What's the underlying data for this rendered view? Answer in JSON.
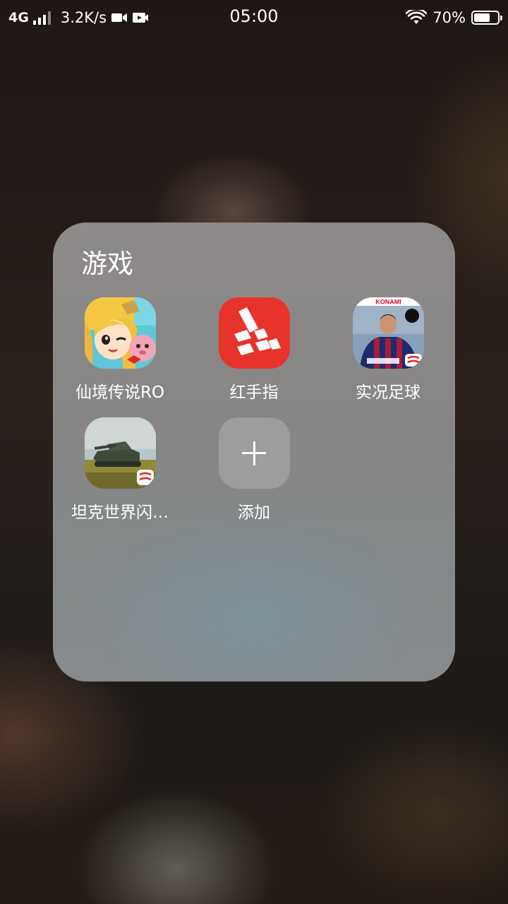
{
  "status_bar": {
    "network_type": "4G",
    "speed": "3.2K/s",
    "time": "05:00",
    "battery_percent": "70%",
    "battery_level": 0.7,
    "icons": [
      "signal-icon",
      "video-camera-icon",
      "video-record-icon",
      "wifi-icon",
      "battery-icon"
    ]
  },
  "folder": {
    "title": "游戏",
    "apps": [
      {
        "label": "仙境传说RO",
        "icon": "anime-girl-game-icon"
      },
      {
        "label": "红手指",
        "icon": "red-finger-logo-icon"
      },
      {
        "label": "实况足球",
        "icon": "football-player-icon",
        "icon_text": "KONAMI"
      },
      {
        "label": "坦克世界闪…",
        "icon": "tank-game-icon"
      },
      {
        "label": "添加",
        "icon": "plus-icon"
      }
    ]
  },
  "colors": {
    "red_finger": "#e8332c",
    "folder_bg": "#8a8988"
  }
}
